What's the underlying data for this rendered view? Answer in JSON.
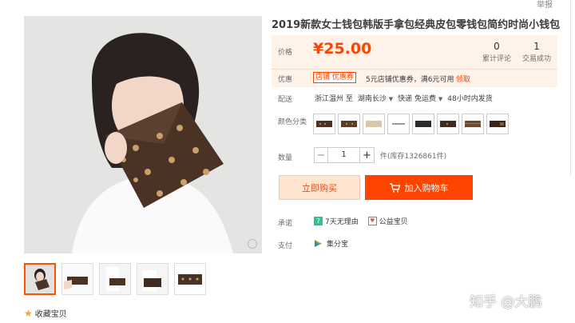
{
  "header": {
    "report_link": "举报"
  },
  "product": {
    "title": "2019新款女士钱包韩版手拿包经典皮包零钱包简约时尚小钱包",
    "price_label": "价格",
    "price": "¥25.00",
    "review_count": "0",
    "review_label": "累计评论",
    "sales_count": "1",
    "sales_label": "交易成功"
  },
  "promo": {
    "label": "优惠",
    "coupon_badge": "店铺 优惠券",
    "text": "5元店铺优惠券，满6元可用",
    "get_link": "领取"
  },
  "shipping": {
    "label": "配送",
    "from": "浙江温州 至",
    "to": "湖南长沙",
    "method": "快递 免运费",
    "eta": "48小时内发货"
  },
  "color": {
    "label": "颜色分类",
    "swatches": [
      "brown-monogram",
      "brown-monogram",
      "beige",
      "white",
      "black",
      "brown-monogram",
      "brown-check",
      "dark-brown"
    ]
  },
  "quantity": {
    "label": "数量",
    "minus": "−",
    "value": "1",
    "plus": "+",
    "stock": "件(库存1326861件)"
  },
  "actions": {
    "buy_now": "立即购买",
    "add_to_cart": "加入购物车"
  },
  "promise": {
    "label": "承诺",
    "seven_day_badge": "7",
    "seven_day": "7天无理由",
    "charity": "公益宝贝"
  },
  "payment": {
    "label": "支付",
    "method": "集分宝"
  },
  "favorite": {
    "label": "收藏宝贝"
  },
  "watermark": "知乎 @大鹏",
  "colors": {
    "accent": "#ff4400",
    "price_bg": "#fff2e8",
    "buy_bg": "#ffe4d0"
  }
}
